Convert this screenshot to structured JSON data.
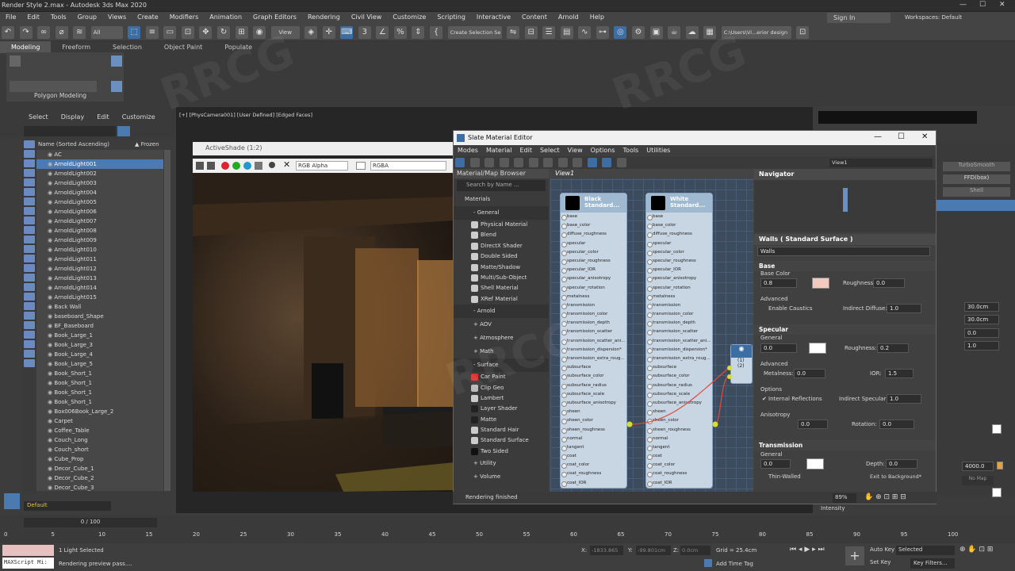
{
  "window": {
    "title": "Render Style 2.max - Autodesk 3ds Max 2020",
    "sign_in": "Sign In",
    "workspaces": "Workspaces: Default"
  },
  "menu": [
    "File",
    "Edit",
    "Tools",
    "Group",
    "Views",
    "Create",
    "Modifiers",
    "Animation",
    "Graph Editors",
    "Rendering",
    "Civil View",
    "Customize",
    "Scripting",
    "Interactive",
    "Content",
    "Arnold",
    "Help"
  ],
  "toolbar": {
    "filter": "All",
    "view": "View",
    "named_selection": "Create Selection Se",
    "path": "C:\\Users\\Vi...erior design"
  },
  "ribbon": {
    "tabs": [
      "Modeling",
      "Freeform",
      "Selection",
      "Object Paint",
      "Populate"
    ],
    "panel_label": "Polygon Modeling"
  },
  "scene_explorer": {
    "menus": [
      "Select",
      "Display",
      "Edit",
      "Customize"
    ],
    "col_name": "Name (Sorted Ascending)",
    "col_frozen": "▲ Frozen",
    "items": [
      "AC",
      "ArnoldLight001",
      "ArnoldLight002",
      "ArnoldLight003",
      "ArnoldLight004",
      "ArnoldLight005",
      "ArnoldLight006",
      "ArnoldLight007",
      "ArnoldLight008",
      "ArnoldLight009",
      "ArnoldLight010",
      "ArnoldLight011",
      "ArnoldLight012",
      "ArnoldLight013",
      "ArnoldLight014",
      "ArnoldLight015",
      "Back Wall",
      "baseboard_Shape",
      "BF_Baseboard",
      "Book_Large_1",
      "Book_Large_3",
      "Book_Large_4",
      "Book_Large_5",
      "Book_Short_1",
      "Book_Short_1",
      "Book_Short_1",
      "Book_Short_1",
      "Box006Book_Large_2",
      "Carpet",
      "Coffee_Table",
      "Couch_Long",
      "Couch_short",
      "Cube_Prop",
      "Decor_Cube_1",
      "Decor_Cube_2",
      "Decor_Cube_3"
    ],
    "selected_index": 1,
    "layer": "Default"
  },
  "viewport": {
    "label": "[+] [PhysCamera001] [User Defined] [Edged Faces]"
  },
  "activeshade": {
    "title": "ActiveShade (1:2)",
    "channel": "RGB Alpha",
    "format": "RGBA"
  },
  "sme": {
    "title": "Slate Material Editor",
    "menu": [
      "Modes",
      "Material",
      "Edit",
      "Select",
      "View",
      "Options",
      "Tools",
      "Utilities"
    ],
    "browser_title": "Material/Map Browser",
    "search_placeholder": "Search by Name ...",
    "materials_header": "Materials",
    "general_header": "- General",
    "general": [
      "Physical Material",
      "Blend",
      "DirectX Shader",
      "Double Sided",
      "Matte/Shadow",
      "Multi/Sub-Object",
      "Shell Material",
      "XRef Material"
    ],
    "arnold_header": "- Arnold",
    "arnold_cats": [
      "+ AOV",
      "+ Atmosphere",
      "+ Math"
    ],
    "surface_header": "- Surface",
    "surface": [
      "Car Paint",
      "Clip Geo",
      "Lambert",
      "Layer Shader",
      "Matte",
      "Standard Hair",
      "Standard Surface",
      "Two Sided"
    ],
    "more_cats": [
      "+ Utility",
      "+ Volume"
    ],
    "view_tab": "View1",
    "view_select": "View1",
    "nodes": [
      {
        "title": "Black Standard..."
      },
      {
        "title": "White Standard..."
      }
    ],
    "slots": [
      "base",
      "base_color",
      "diffuse_roughness",
      "specular",
      "specular_color",
      "specular_roughness",
      "specular_IOR",
      "specular_anisotropy",
      "specular_rotation",
      "metalness",
      "transmission",
      "transmission_color",
      "transmission_depth",
      "transmission_scatter",
      "transmission_scatter_ani...",
      "transmission_dispersion*",
      "transmission_extra_roug...",
      "subsurface",
      "subsurface_color",
      "subsurface_radius",
      "subsurface_scale",
      "subsurface_anisotropy",
      "sheen",
      "sheen_color",
      "sheen_roughness",
      "normal",
      "tangent",
      "coat",
      "coat_color",
      "coat_roughness",
      "coat_IOR"
    ],
    "mix_inputs": [
      "(1)",
      "(2)"
    ],
    "navigator": "Navigator",
    "status": "Rendering finished",
    "zoom": "89%"
  },
  "params": {
    "header": "Walls  ( Standard Surface )",
    "name": "Walls",
    "base": {
      "title": "Base",
      "color_label": "Base Color",
      "weight": "0.8",
      "roughness_label": "Roughness:",
      "roughness": "0.0",
      "advanced": "Advanced",
      "caustics": "Enable Caustics",
      "indirect_diffuse_label": "Indirect Diffuse:",
      "indirect_diffuse": "1.0"
    },
    "specular": {
      "title": "Specular",
      "general": "General",
      "weight": "0.0",
      "roughness_label": "Roughness:",
      "roughness": "0.2",
      "advanced": "Advanced",
      "metalness_label": "Metalness:",
      "metalness": "0.0",
      "ior_label": "IOR:",
      "ior": "1.5",
      "options": "Options",
      "internal_reflections": "Internal Reflections",
      "indirect_specular_label": "Indirect Specular:",
      "indirect_specular": "1.0",
      "anisotropy": "Anisotropy",
      "aniso": "0.0",
      "rotation_label": "Rotation:",
      "rotation": "0.0"
    },
    "transmission": {
      "title": "Transmission",
      "general": "General",
      "weight": "0.0",
      "depth_label": "Depth:",
      "depth": "0.0",
      "thin_walled": "Thin-Walled",
      "exit_bg": "Exit to Background*"
    }
  },
  "command_panel": {
    "modifiers": [
      "TurboSmooth",
      "FFD(box)",
      "Shell"
    ],
    "values": [
      "30.0cm",
      "30.0cm",
      "0.0",
      "1.0",
      "4000.0"
    ],
    "no_map": "No Map",
    "intensity": "Intensity"
  },
  "timeline": {
    "frame": "0 / 100",
    "ticks": [
      "0",
      "5",
      "10",
      "15",
      "20",
      "25",
      "30",
      "35",
      "40",
      "45",
      "50",
      "55",
      "60",
      "65",
      "70",
      "75",
      "80",
      "85",
      "90",
      "95",
      "100"
    ]
  },
  "statusbar": {
    "selected": "1 Light Selected",
    "prompt": "Rendering preview pass....",
    "script": "MAXScript Mi:",
    "x_label": "X:",
    "x": "-1833.865",
    "y_label": "Y:",
    "y": "-99.801cm",
    "z_label": "Z:",
    "z": "0.0cm",
    "grid": "Grid = 25.4cm",
    "add_time_tag": "Add Time Tag",
    "auto_key": "Auto Key",
    "set_key": "Set Key",
    "selected_mode": "Selected",
    "key_filters": "Key Filters..."
  },
  "colors": {
    "accent": "#4a7ab0",
    "base_color": "#f1c9bf",
    "spec_color": "#ffffff",
    "wire": "#e04a3a",
    "anchor": "#d4e02a"
  }
}
